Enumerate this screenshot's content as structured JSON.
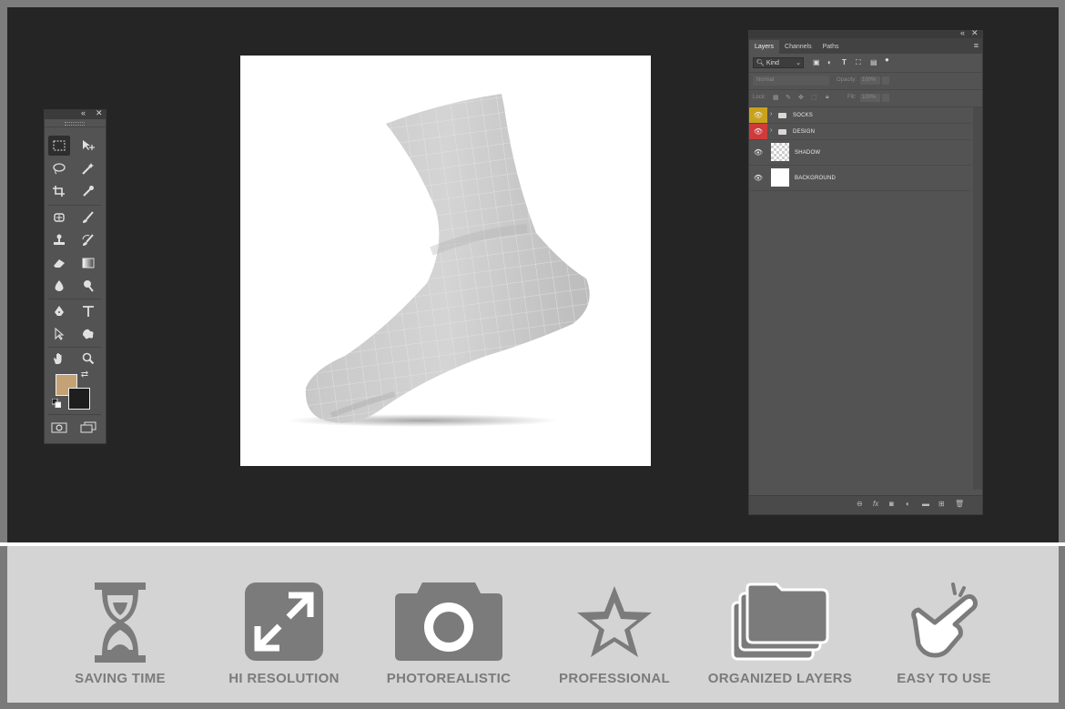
{
  "toolbox": {
    "collapse_icon": "«",
    "close_icon": "✕",
    "foreground_color": "#c4a276",
    "background_color": "#1e1e1e"
  },
  "layers_panel": {
    "tabs": [
      "Layers",
      "Channels",
      "Paths"
    ],
    "filter_kind": "Kind",
    "blend_mode": "Normal",
    "opacity_label": "Opacity:",
    "opacity_value": "100%",
    "lock_label": "Lock:",
    "fill_label": "Fill:",
    "fill_value": "100%",
    "layers": [
      {
        "name": "SOCKS",
        "type": "group",
        "eye_color": "#c9a21b"
      },
      {
        "name": "DESIGN",
        "type": "group",
        "eye_color": "#cf3b3b"
      },
      {
        "name": "SHADOW",
        "type": "layer"
      },
      {
        "name": "BACKGROUND",
        "type": "layer"
      }
    ]
  },
  "features": [
    {
      "label": "SAVING TIME",
      "icon": "hourglass-icon"
    },
    {
      "label": "HI RESOLUTION",
      "icon": "expand-arrows-icon"
    },
    {
      "label": "PHOTOREALISTIC",
      "icon": "camera-icon"
    },
    {
      "label": "PROFESSIONAL",
      "icon": "star-icon"
    },
    {
      "label": "ORGANIZED LAYERS",
      "icon": "folders-icon"
    },
    {
      "label": "EASY TO USE",
      "icon": "tap-hand-icon"
    }
  ]
}
